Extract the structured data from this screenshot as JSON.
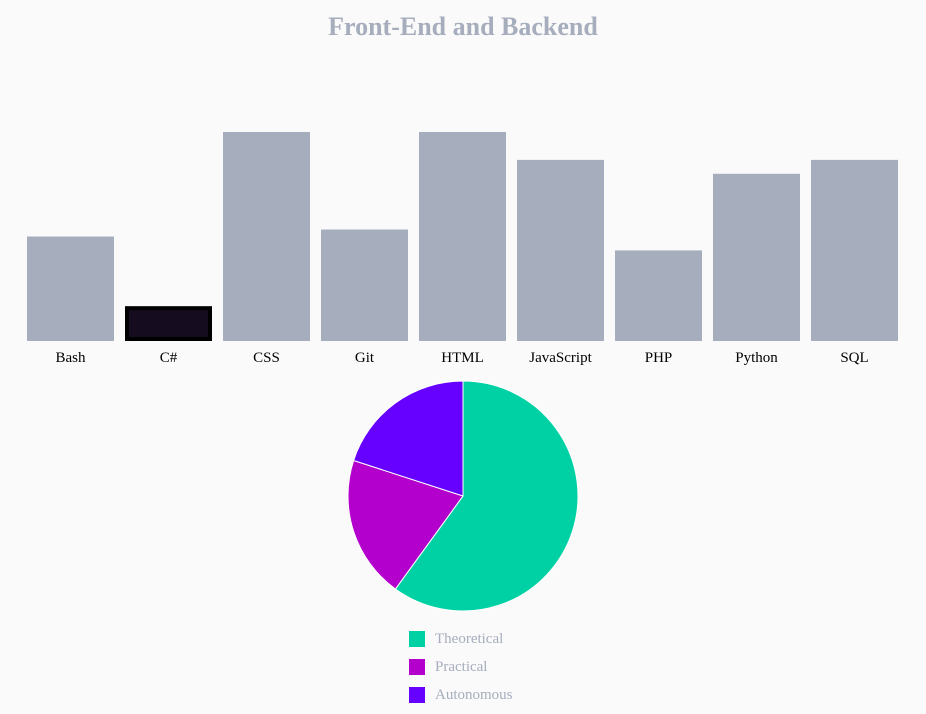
{
  "page": {
    "title": "Front-End and Backend"
  },
  "colors": {
    "title": "#a6adbd",
    "bar_fill": "#a6adbd",
    "bar_highlight_fill": "#150d1f",
    "bar_highlight_stroke": "#000000",
    "axis_text": "#000000",
    "legend_text": "#a6adbd"
  },
  "chart_data": [
    {
      "type": "bar",
      "title": "Front-End and Backend",
      "categories": [
        "Bash",
        "C#",
        "CSS",
        "Git",
        "HTML",
        "JavaScript",
        "PHP",
        "Python",
        "SQL"
      ],
      "values": [
        3,
        1,
        6,
        3.2,
        6,
        5.2,
        2.6,
        4.8,
        5.2
      ],
      "highlighted_category": "C#",
      "ylim": [
        0,
        6
      ],
      "grid": false,
      "xlabel": "",
      "ylabel": ""
    },
    {
      "type": "pie",
      "labels": [
        "Theoretical",
        "Practical",
        "Autonomous"
      ],
      "values": [
        60,
        20,
        20
      ],
      "colors": [
        "#00d1a5",
        "#b300cc",
        "#6600ff"
      ],
      "legend_position": "bottom"
    }
  ]
}
